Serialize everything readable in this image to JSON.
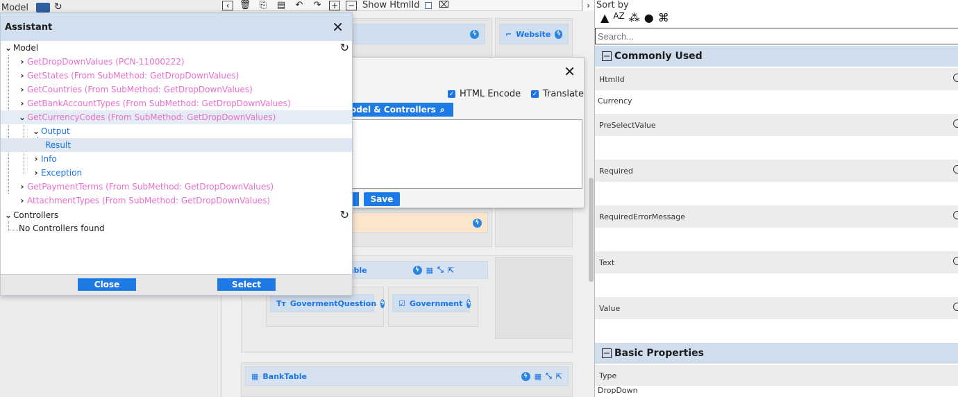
{
  "left_panel": {
    "model_tab": "Model"
  },
  "toolbar": {
    "show_htmlid_label": "Show HtmlId"
  },
  "canvas": {
    "website_label": "Website",
    "table_label": "Table",
    "govq_label": "GovermentQuestion",
    "gov_label": "Government",
    "bank_label": "BankTable"
  },
  "props": {
    "sort_by": "Sort by",
    "search_placeholder": "Search...",
    "section_common": "Commonly Used",
    "section_basic": "Basic Properties",
    "htmlid_label": "HtmlId",
    "htmlid_value": "Currency",
    "preselect_label": "PreSelectValue",
    "required_label": "Required",
    "required_err_label": "RequiredErrorMessage",
    "text_label": "Text",
    "value_label": "Value",
    "type_label": "Type",
    "type_value": "DropDown"
  },
  "edit_dialog": {
    "html_encode": "HTML Encode",
    "translate": "Translate",
    "model_controllers_btn": "odel & Controllers",
    "save": "Save"
  },
  "assistant": {
    "title": "Assistant",
    "model_root": "Model",
    "items": [
      "GetDropDownValues (PCN-11000222)",
      "GetStates (From SubMethod: GetDropDownValues)",
      "GetCountries (From SubMethod: GetDropDownValues)",
      "GetBankAccountTypes (From SubMethod: GetDropDownValues)",
      "GetCurrencyCodes (From SubMethod: GetDropDownValues)",
      "Output",
      "Result",
      "Info",
      "Exception",
      "GetPaymentTerms (From SubMethod: GetDropDownValues)",
      "AttachmentTypes (From SubMethod: GetDropDownValues)"
    ],
    "controllers_root": "Controllers",
    "no_controllers": "No Controllers found",
    "close_btn": "Close",
    "select_btn": "Select"
  }
}
